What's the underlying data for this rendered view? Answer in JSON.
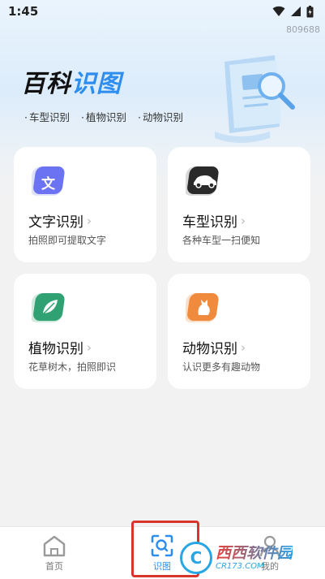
{
  "status": {
    "time": "1:45"
  },
  "build_id": "809688",
  "brand": {
    "part1": "百科",
    "part2": "识图"
  },
  "tags": [
    "车型识别",
    "植物识别",
    "动物识别"
  ],
  "cards": [
    {
      "title": "文字识别",
      "subtitle": "拍照即可提取文字",
      "icon": "text-icon",
      "icon_glyph": "文",
      "color": "#6b73f2"
    },
    {
      "title": "车型识别",
      "subtitle": "各种车型一扫便知",
      "icon": "car-icon",
      "color": "#2a2a2a"
    },
    {
      "title": "植物识别",
      "subtitle": "花草树木，拍照即识",
      "icon": "leaf-icon",
      "color": "#2fa172"
    },
    {
      "title": "动物识别",
      "subtitle": "认识更多有趣动物",
      "icon": "cat-icon",
      "color": "#f08a3c"
    }
  ],
  "nav": {
    "items": [
      {
        "label": "首页",
        "icon": "home-icon"
      },
      {
        "label": "识图",
        "icon": "scan-icon",
        "active": true
      },
      {
        "label": "我的",
        "icon": "profile-icon"
      }
    ]
  },
  "watermark": {
    "main": "西西软件园",
    "url": "CR173.COM",
    "logo_glyph": "C"
  },
  "colors": {
    "accent": "#2e8ef0",
    "highlight": "#d9352c"
  }
}
